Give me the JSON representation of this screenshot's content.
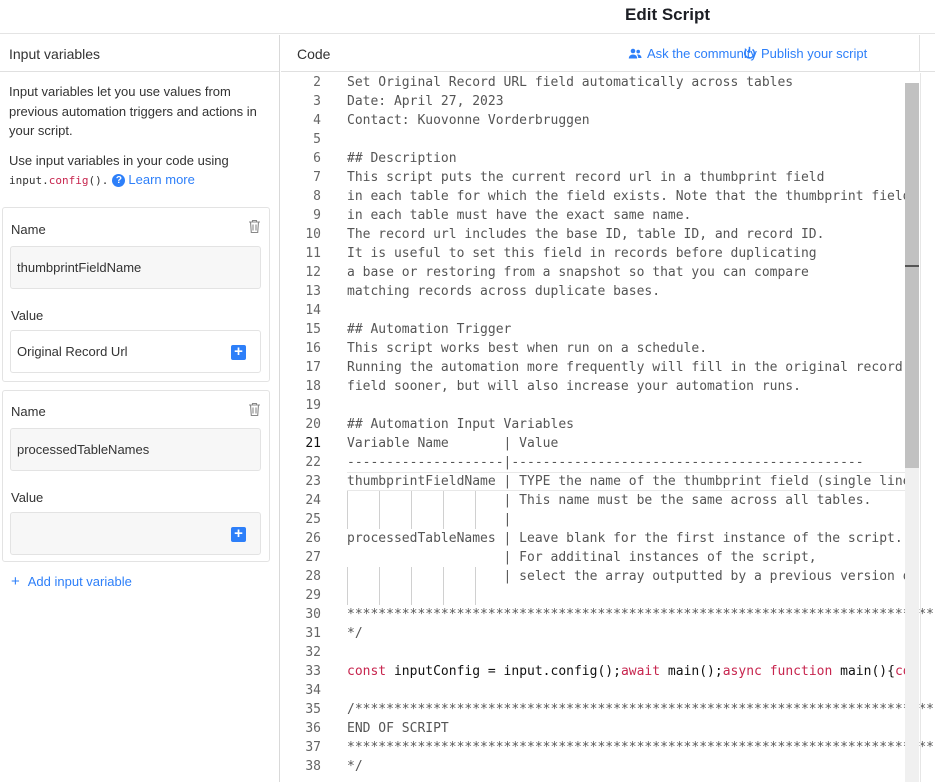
{
  "header": {
    "title": "Edit Script"
  },
  "input_panel": {
    "title": "Input variables",
    "desc1": "Input variables let you use values from previous automation triggers and actions in your script.",
    "desc2_prefix": "Use input variables in your code using",
    "code_input": "input",
    "code_dot": ".",
    "code_config": "config",
    "code_parens": "().",
    "learn_more": "Learn more",
    "variables": [
      {
        "name_label": "Name",
        "name_value": "thumbprintFieldName",
        "value_label": "Value",
        "value_value": "Original Record Url"
      },
      {
        "name_label": "Name",
        "name_value": "processedTableNames",
        "value_label": "Value",
        "value_value": ""
      }
    ],
    "add_label": "Add input variable"
  },
  "code_panel": {
    "title": "Code",
    "ask_community": "Ask the community",
    "publish": "Publish your script",
    "active_line": 21,
    "lines": [
      {
        "n": "2",
        "t": "Set Original Record URL field automatically across tables"
      },
      {
        "n": "3",
        "t": "Date: April 27, 2023"
      },
      {
        "n": "4",
        "t": "Contact: Kuovonne Vorderbruggen"
      },
      {
        "n": "5",
        "t": ""
      },
      {
        "n": "6",
        "t": "## Description"
      },
      {
        "n": "7",
        "t": "This script puts the current record url in a thumbprint field"
      },
      {
        "n": "8",
        "t": "in each table for which the field exists. Note that the thumbprint field"
      },
      {
        "n": "9",
        "t": "in each table must have the exact same name."
      },
      {
        "n": "10",
        "t": "The record url includes the base ID, table ID, and record ID."
      },
      {
        "n": "11",
        "t": "It is useful to set this field in records before duplicating"
      },
      {
        "n": "12",
        "t": "a base or restoring from a snapshot so that you can compare"
      },
      {
        "n": "13",
        "t": "matching records across duplicate bases."
      },
      {
        "n": "14",
        "t": ""
      },
      {
        "n": "15",
        "t": "## Automation Trigger"
      },
      {
        "n": "16",
        "t": "This script works best when run on a schedule."
      },
      {
        "n": "17",
        "t": "Running the automation more frequently will fill in the original record"
      },
      {
        "n": "18",
        "t": "field sooner, but will also increase your automation runs."
      },
      {
        "n": "19",
        "t": ""
      },
      {
        "n": "20",
        "t": "## Automation Input Variables"
      },
      {
        "n": "21",
        "t": "Variable Name       | Value"
      },
      {
        "n": "22",
        "t": "--------------------|---------------------------------------------"
      },
      {
        "n": "23",
        "t": "thumbprintFieldName | TYPE the name of the thumbprint field (single line"
      },
      {
        "n": "24",
        "t": "                    | This name must be the same across all tables."
      },
      {
        "n": "25",
        "t": "                    |"
      },
      {
        "n": "26",
        "t": "processedTableNames | Leave blank for the first instance of the script."
      },
      {
        "n": "27",
        "t": "                    | For additinal instances of the script,"
      },
      {
        "n": "28",
        "t": "                    | select the array outputted by a previous version of"
      },
      {
        "n": "29",
        "t": ""
      },
      {
        "n": "30",
        "t": "****************************************************************************"
      },
      {
        "n": "31",
        "t": "*/"
      },
      {
        "n": "32",
        "t": ""
      },
      {
        "n": "33",
        "t": ""
      },
      {
        "n": "34",
        "t": ""
      },
      {
        "n": "35",
        "t": "/***************************************************************************"
      },
      {
        "n": "36",
        "t": "END OF SCRIPT"
      },
      {
        "n": "37",
        "t": "****************************************************************************"
      },
      {
        "n": "38",
        "t": "*/"
      }
    ],
    "line33": {
      "kw_const": "const",
      "p1": " inputConfig = input.config();",
      "kw_await": "await",
      "p2": " main();",
      "kw_async": "async",
      "p3": " ",
      "kw_function": "function",
      "p4": " main(){",
      "kw_co": "co"
    }
  }
}
